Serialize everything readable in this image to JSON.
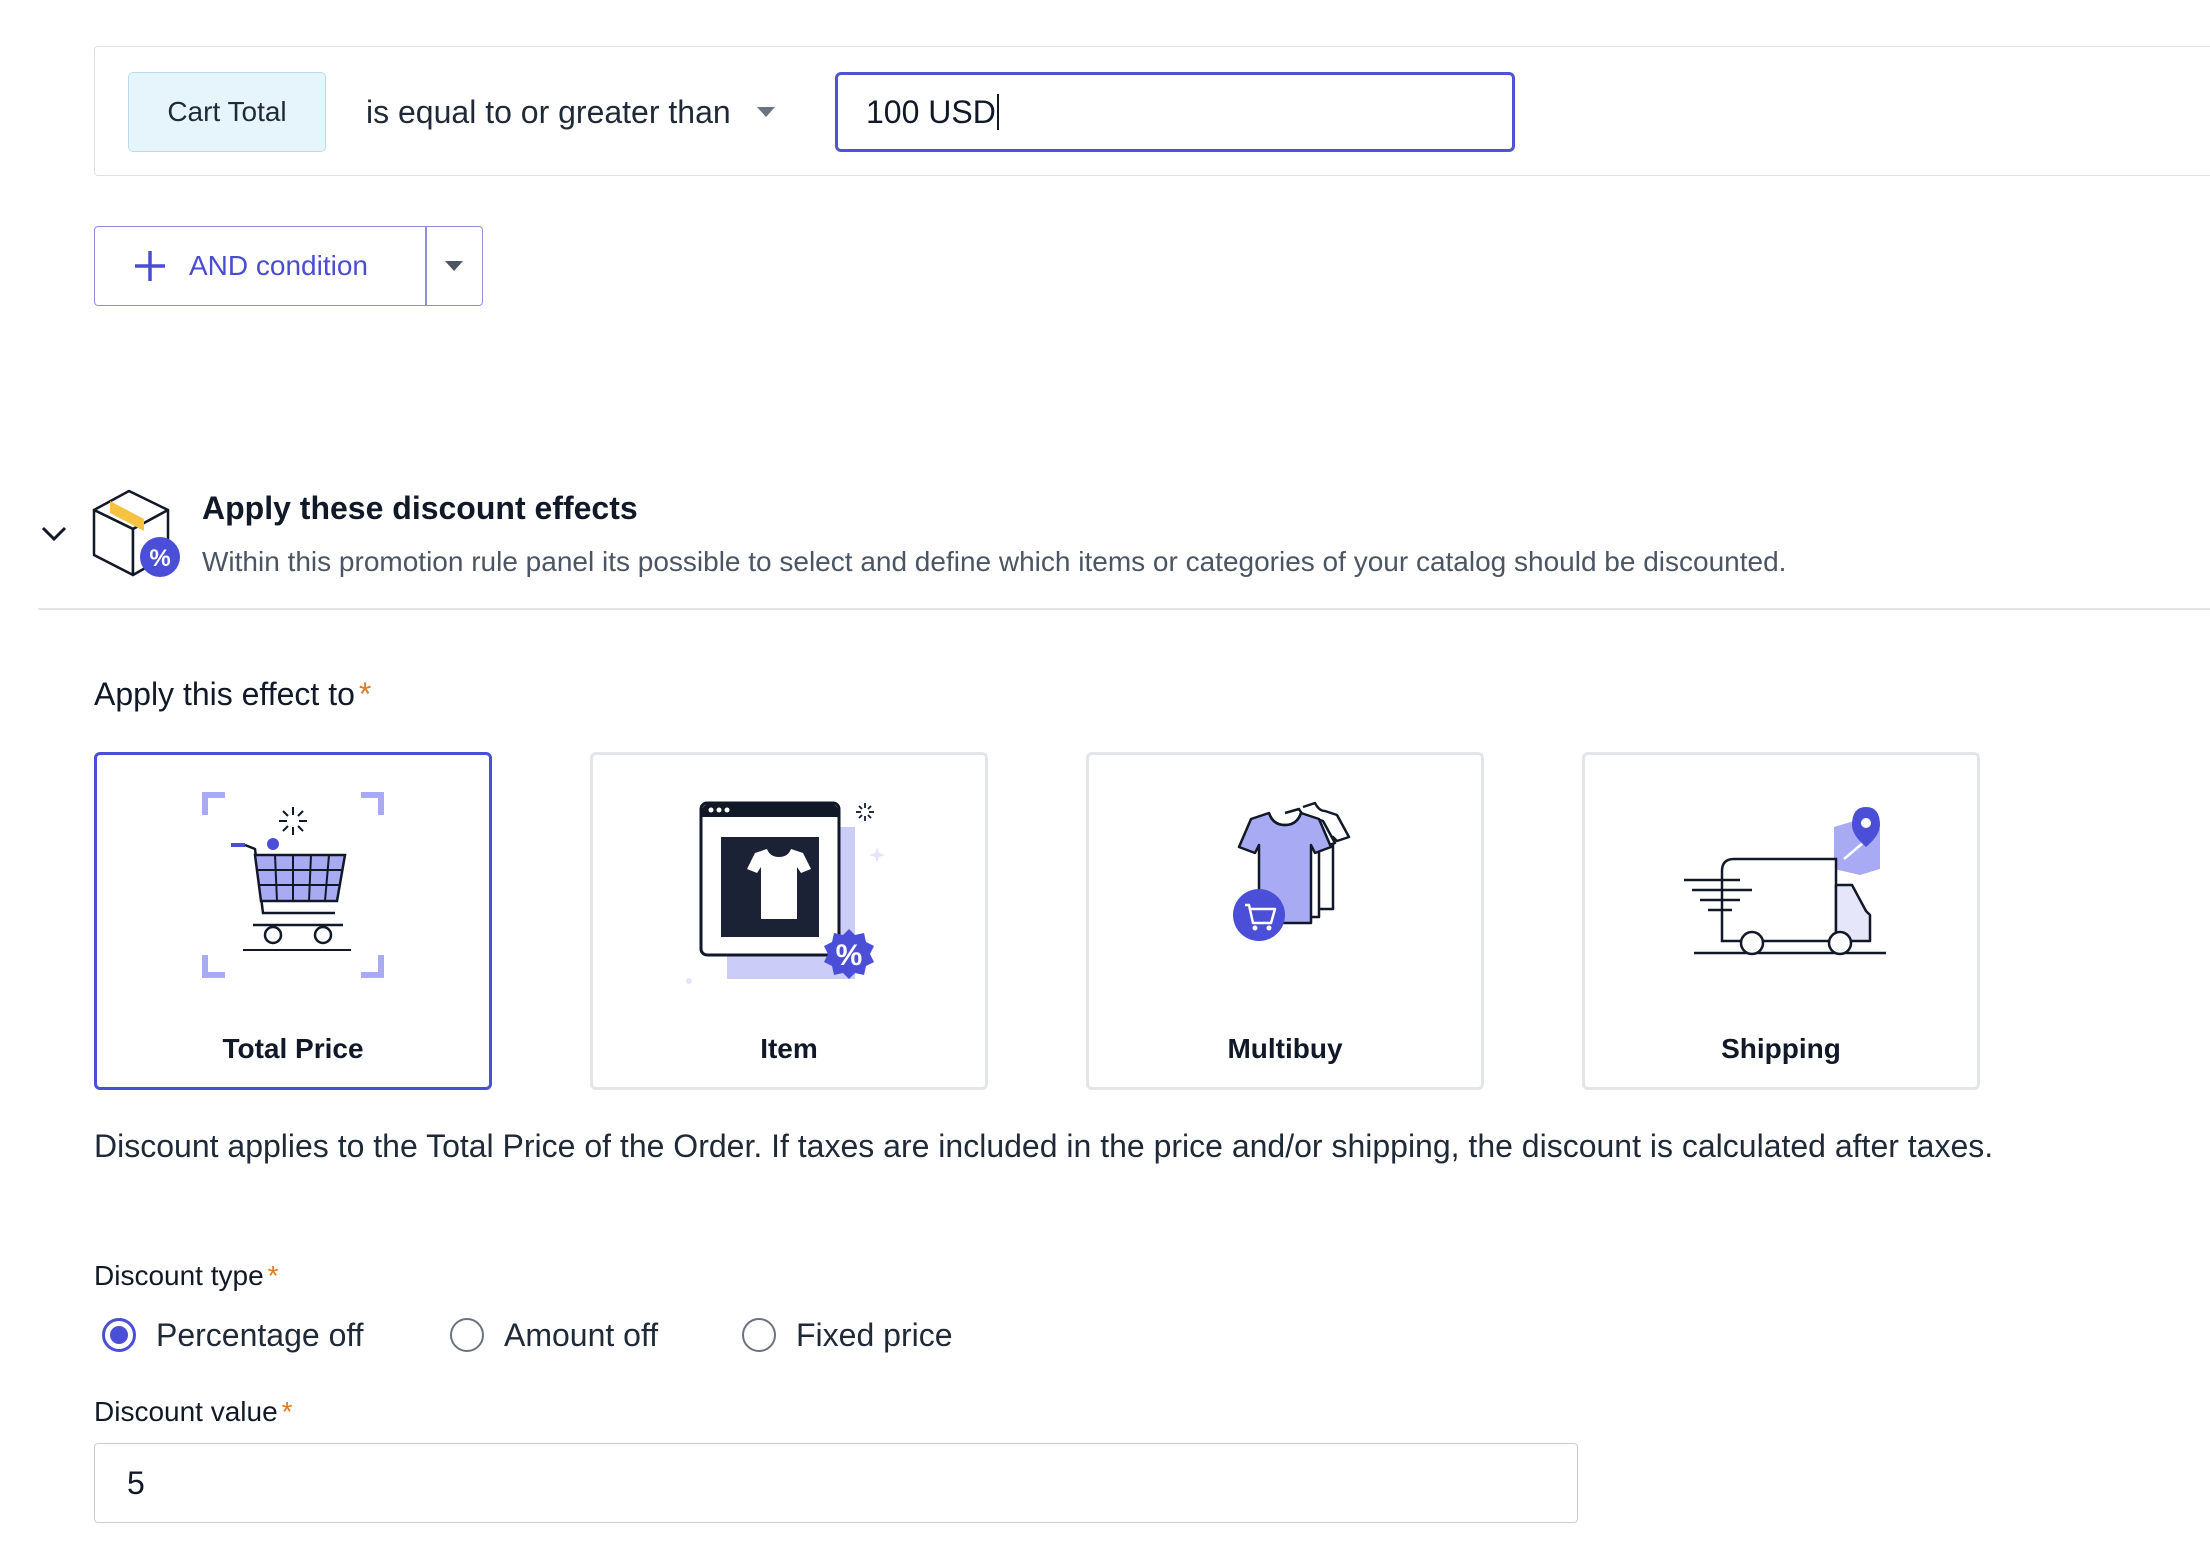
{
  "condition": {
    "field_tag": "Cart Total",
    "operator": "is equal to or greater than",
    "value": "100 USD"
  },
  "and_condition": {
    "label": "AND condition"
  },
  "effects_section": {
    "title": "Apply these discount effects",
    "description": "Within this promotion rule panel its possible to select and define which items or categories of your catalog should be discounted."
  },
  "apply_to": {
    "label": "Apply this effect to",
    "required_mark": "*",
    "options": [
      {
        "label": "Total Price",
        "selected": true
      },
      {
        "label": "Item",
        "selected": false
      },
      {
        "label": "Multibuy",
        "selected": false
      },
      {
        "label": "Shipping",
        "selected": false
      }
    ],
    "info_text": "Discount applies to the Total Price of the Order. If taxes are included in the price and/or shipping, the discount is calculated after taxes."
  },
  "discount_type": {
    "label": "Discount type",
    "required_mark": "*",
    "options": [
      {
        "label": "Percentage off",
        "checked": true
      },
      {
        "label": "Amount off",
        "checked": false
      },
      {
        "label": "Fixed price",
        "checked": false
      }
    ]
  },
  "discount_value": {
    "label": "Discount value",
    "required_mark": "*",
    "value": "5"
  },
  "colors": {
    "accent": "#4b4ed6",
    "tag_bg": "#e6f4fb",
    "required": "#e07a1e",
    "illustration_fill": "#a9aaf4"
  },
  "icons": {
    "add": "plus-icon",
    "dropdown": "caret-down-icon",
    "collapse": "chevron-down-icon",
    "section": "discount-box-icon",
    "cards": [
      "shopping-cart-icon",
      "item-shirt-icon",
      "multibuy-shirts-icon",
      "shipping-truck-icon"
    ]
  }
}
